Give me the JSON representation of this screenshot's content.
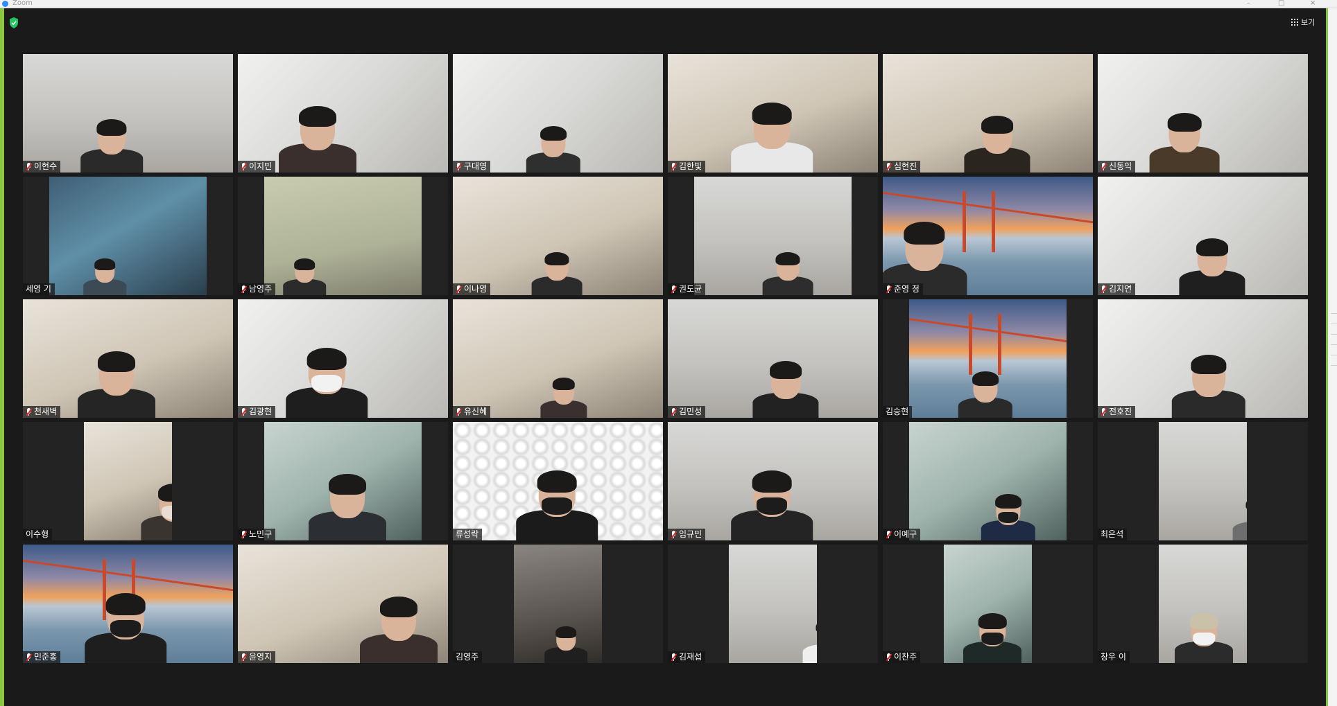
{
  "window": {
    "title": "Zoom"
  },
  "toolbar": {
    "view_label": "보기"
  },
  "participants": [
    {
      "name": "이현수",
      "muted": true
    },
    {
      "name": "이지민",
      "muted": true
    },
    {
      "name": "구대영",
      "muted": true
    },
    {
      "name": "김한빛",
      "muted": true
    },
    {
      "name": "심현진",
      "muted": true
    },
    {
      "name": "신동익",
      "muted": true
    },
    {
      "name": "세영 기",
      "muted": false
    },
    {
      "name": "남영주",
      "muted": true
    },
    {
      "name": "이나영",
      "muted": true
    },
    {
      "name": "권도균",
      "muted": true
    },
    {
      "name": "준영 정",
      "muted": true
    },
    {
      "name": "김지연",
      "muted": true
    },
    {
      "name": "천새벽",
      "muted": true
    },
    {
      "name": "김광현",
      "muted": true
    },
    {
      "name": "유신혜",
      "muted": true
    },
    {
      "name": "김민성",
      "muted": true
    },
    {
      "name": "김승현",
      "muted": false
    },
    {
      "name": "전호진",
      "muted": true
    },
    {
      "name": "이수형",
      "muted": false
    },
    {
      "name": "노민구",
      "muted": true
    },
    {
      "name": "류성락",
      "muted": false
    },
    {
      "name": "임규민",
      "muted": true
    },
    {
      "name": "이예구",
      "muted": true
    },
    {
      "name": "최은석",
      "muted": false
    },
    {
      "name": "민준홍",
      "muted": true
    },
    {
      "name": "윤영지",
      "muted": true
    },
    {
      "name": "김영주",
      "muted": false
    },
    {
      "name": "김재섭",
      "muted": true
    },
    {
      "name": "이찬주",
      "muted": true
    },
    {
      "name": "창우 이",
      "muted": false
    }
  ]
}
